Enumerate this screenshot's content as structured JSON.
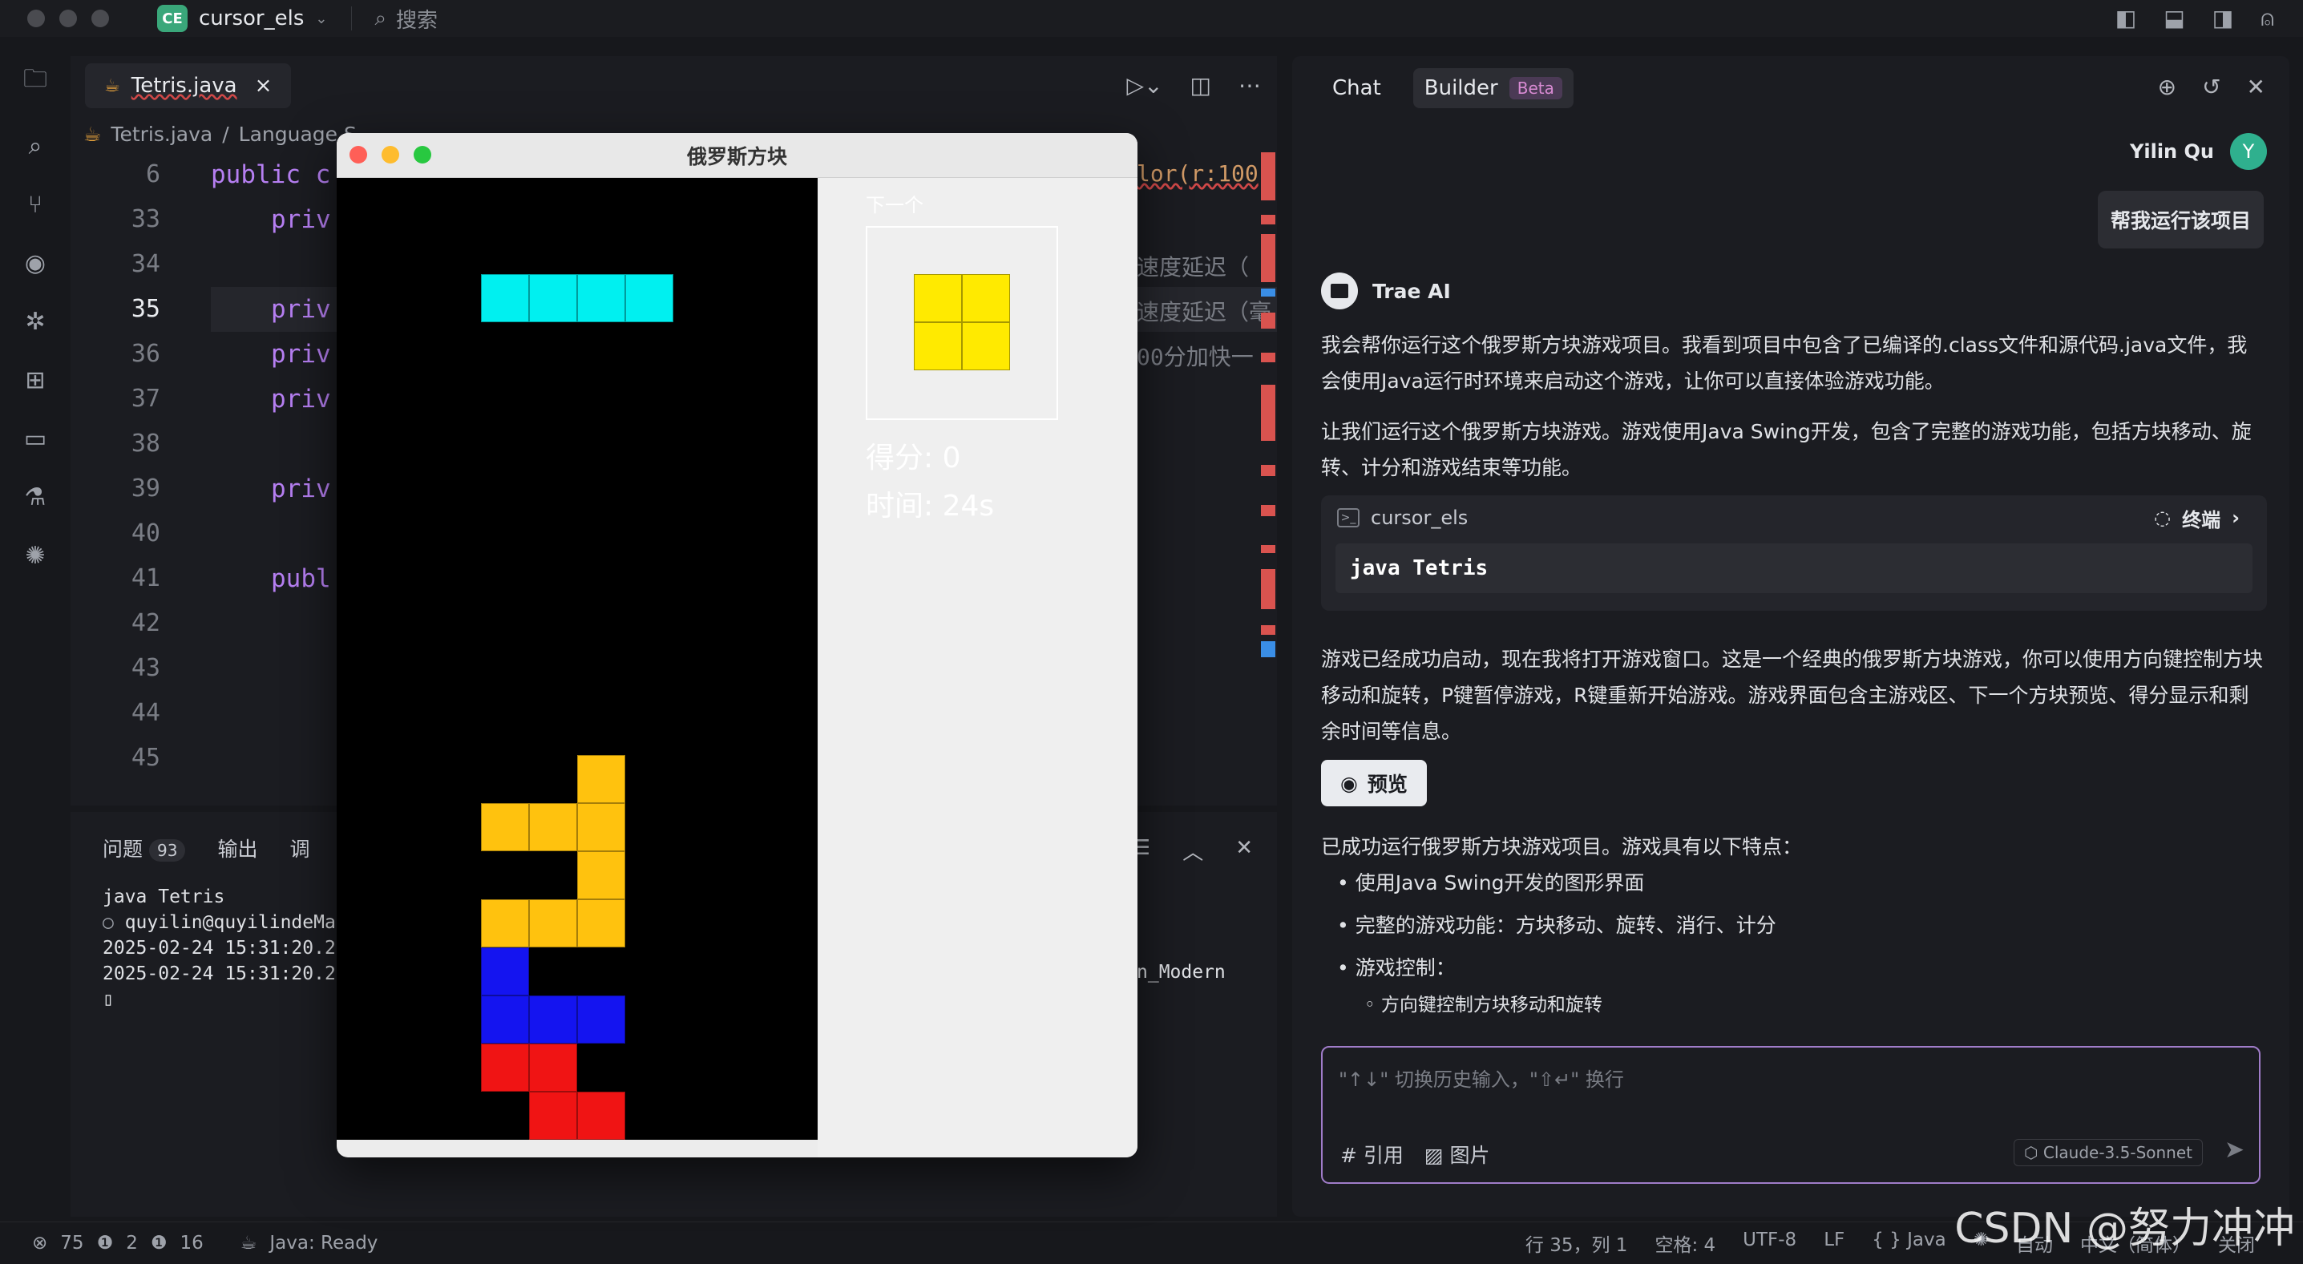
{
  "titlebar": {
    "project_badge": "CE",
    "project_name": "cursor_els",
    "search_label": "搜索"
  },
  "editor": {
    "tab_name": "Tetris.java",
    "breadcrumb": [
      "Tetris.java",
      "Language S"
    ],
    "line_numbers": [
      "6",
      "33",
      "34",
      "35",
      "36",
      "37",
      "38",
      "39",
      "40",
      "41",
      "42",
      "43",
      "44",
      "45"
    ],
    "active_line": "35",
    "code": {
      "l6": "public c",
      "l33": "priv",
      "l35": "priv",
      "l36": "priv",
      "l37": "priv",
      "l39": "priv",
      "l41": "publ"
    },
    "right_fragments": {
      "f33": "lor(r:100",
      "f35": "速度延迟（",
      "f36": "速度延迟（毫",
      "f37": "00分加快一"
    }
  },
  "panel": {
    "tab_problems": "问题",
    "problems_count": "93",
    "tab_output": "输出",
    "tab_partial": "调",
    "terminal": [
      "java Tetris",
      "quyilin@quyilindeMacB",
      "2025-02-24 15:31:20.2",
      "2025-02-24 15:31:20.2",
      "▯"
    ],
    "terminal_right": "n_Modern"
  },
  "status": {
    "errors": "75",
    "warnings": "2",
    "infos": "16",
    "java_state": "Java: Ready",
    "position": "行 35，列 1",
    "spaces": "空格: 4",
    "encoding": "UTF-8",
    "eol": "LF",
    "language": "{ } Java",
    "auto": "自动",
    "ime": "中文（简体）",
    "close": "关闭"
  },
  "watermark": "CSDN @努力冲冲",
  "ai": {
    "tab_chat": "Chat",
    "tab_builder": "Builder",
    "beta": "Beta",
    "user_name": "Yilin Qu",
    "user_initial": "Y",
    "user_message": "帮我运行该项目",
    "bot_name": "Trae AI",
    "p1": "我会帮你运行这个俄罗斯方块游戏项目。我看到项目中包含了已编译的.class文件和源代码.java文件，我会使用Java运行时环境来启动这个游戏，让你可以直接体验游戏功能。",
    "p2": "让我们运行这个俄罗斯方块游戏。游戏使用Java Swing开发，包含了完整的游戏功能，包括方块移动、旋转、计分和游戏结束等功能。",
    "term_project": "cursor_els",
    "term_label": "终端",
    "term_cmd": "java Tetris",
    "p3": "游戏已经成功启动，现在我将打开游戏窗口。这是一个经典的俄罗斯方块游戏，你可以使用方向键控制方块移动和旋转，P键暂停游戏，R键重新开始游戏。游戏界面包含主游戏区、下一个方块预览、得分显示和剩余时间等信息。",
    "preview": "预览",
    "p4": "已成功运行俄罗斯方块游戏项目。游戏具有以下特点：",
    "bullets": [
      "使用Java Swing开发的图形界面",
      "完整的游戏功能：方块移动、旋转、消行、计分",
      "游戏控制："
    ],
    "sub_bullet": "方向键控制方块移动和旋转",
    "input_placeholder": "\"↑↓\" 切换历史输入，\"⇧↵\" 换行",
    "tool_ref": "# 引用",
    "tool_image": "图片",
    "model": "Claude-3.5-Sonnet"
  },
  "tetris": {
    "title": "俄罗斯方块",
    "next_label": "下一个",
    "score": "得分: 0",
    "time": "时间: 24s",
    "colors": {
      "cyan": "#00f0f0",
      "yellow": "#ffea00",
      "gold": "#ffc20e",
      "blue": "#1414f0",
      "red": "#f01414"
    }
  }
}
